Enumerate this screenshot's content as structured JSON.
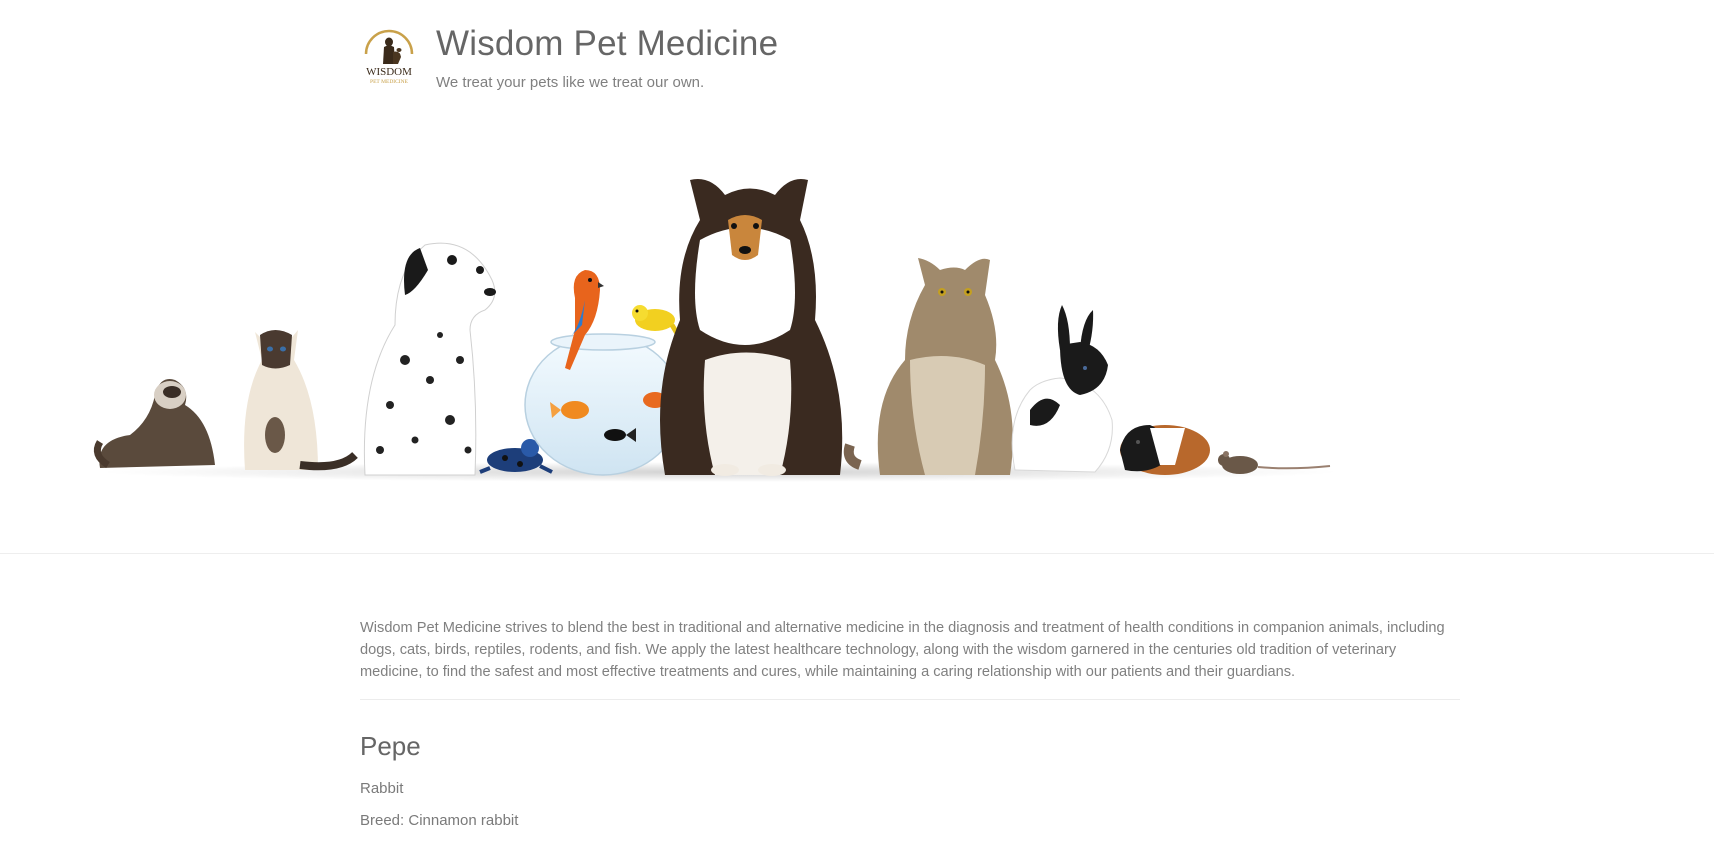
{
  "header": {
    "logo_text_top": "WISDOM",
    "logo_text_bottom": "PET MEDICINE",
    "title": "Wisdom Pet Medicine",
    "tagline": "We treat your pets like we treat our own."
  },
  "hero": {
    "animals": [
      "ferret",
      "siamese-cat",
      "dalmatian",
      "parrot",
      "canary",
      "fishbowl",
      "goldfish",
      "poison-frog",
      "collie",
      "maine-coon-cat",
      "rabbit",
      "guinea-pig",
      "mouse"
    ]
  },
  "intro": {
    "text": "Wisdom Pet Medicine strives to blend the best in traditional and alternative medicine in the diagnosis and treatment of health conditions in companion animals, including dogs, cats, birds, reptiles, rodents, and fish. We apply the latest healthcare technology, along with the wisdom garnered in the centuries old tradition of veterinary medicine, to find the safest and most effective treatments and cures, while maintaining a caring relationship with our patients and their guardians."
  },
  "pet": {
    "name": "Pepe",
    "species": "Rabbit",
    "breed": "Breed: Cinnamon rabbit"
  },
  "colors": {
    "logo_gold": "#c9a14a",
    "logo_dark": "#3a2a1a",
    "text_heading": "#666666",
    "text_body": "#808080"
  }
}
